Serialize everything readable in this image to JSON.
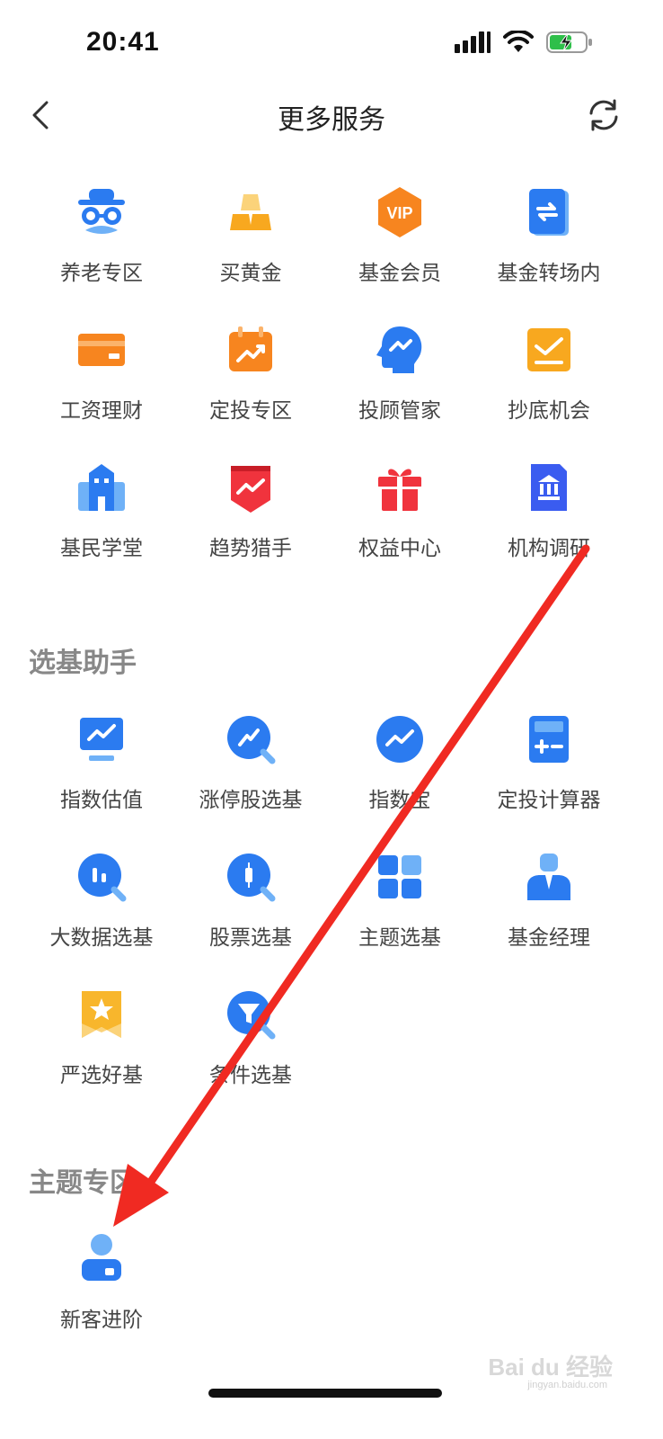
{
  "status_bar": {
    "time": "20:41",
    "icons": [
      "cellular-signal-icon",
      "wifi-icon",
      "battery-charging-icon"
    ]
  },
  "nav": {
    "title": "更多服务",
    "back_icon": "chevron-left-icon",
    "refresh_icon": "refresh-icon"
  },
  "services": {
    "items": [
      {
        "label": "养老专区",
        "icon": "elder-icon"
      },
      {
        "label": "买黄金",
        "icon": "gold-bars-icon"
      },
      {
        "label": "基金会员",
        "icon": "vip-badge-icon"
      },
      {
        "label": "基金转场内",
        "icon": "transfer-icon"
      },
      {
        "label": "工资理财",
        "icon": "card-icon"
      },
      {
        "label": "定投专区",
        "icon": "calendar-trend-icon"
      },
      {
        "label": "投顾管家",
        "icon": "advisor-head-icon"
      },
      {
        "label": "抄底机会",
        "icon": "trend-check-icon"
      },
      {
        "label": "基民学堂",
        "icon": "school-building-icon"
      },
      {
        "label": "趋势猎手",
        "icon": "trend-shield-icon"
      },
      {
        "label": "权益中心",
        "icon": "gift-box-icon"
      },
      {
        "label": "机构调研",
        "icon": "institution-icon"
      }
    ]
  },
  "fund_helper": {
    "title": "选基助手",
    "items": [
      {
        "label": "指数估值",
        "icon": "monitor-chart-icon"
      },
      {
        "label": "涨停股选基",
        "icon": "search-trend-icon"
      },
      {
        "label": "指数宝",
        "icon": "trend-circle-icon"
      },
      {
        "label": "定投计算器",
        "icon": "calculator-icon"
      },
      {
        "label": "大数据选基",
        "icon": "search-bars-icon"
      },
      {
        "label": "股票选基",
        "icon": "search-candle-icon"
      },
      {
        "label": "主题选基",
        "icon": "grid-tiles-icon"
      },
      {
        "label": "基金经理",
        "icon": "manager-icon"
      },
      {
        "label": "严选好基",
        "icon": "star-bookmark-icon"
      },
      {
        "label": "条件选基",
        "icon": "search-filter-icon"
      }
    ]
  },
  "theme_zone": {
    "title": "主题专区",
    "items": [
      {
        "label": "新客进阶",
        "icon": "new-user-icon"
      }
    ]
  },
  "watermark": {
    "text": "Bai du 经验",
    "sub": "jingyan.baidu.com"
  },
  "colors": {
    "blue": "#2b7bf0",
    "light_blue": "#6fb1f7",
    "orange": "#f7851f",
    "gold": "#f8b62c",
    "red": "#f0333d",
    "arrow_red": "#f02a22"
  }
}
